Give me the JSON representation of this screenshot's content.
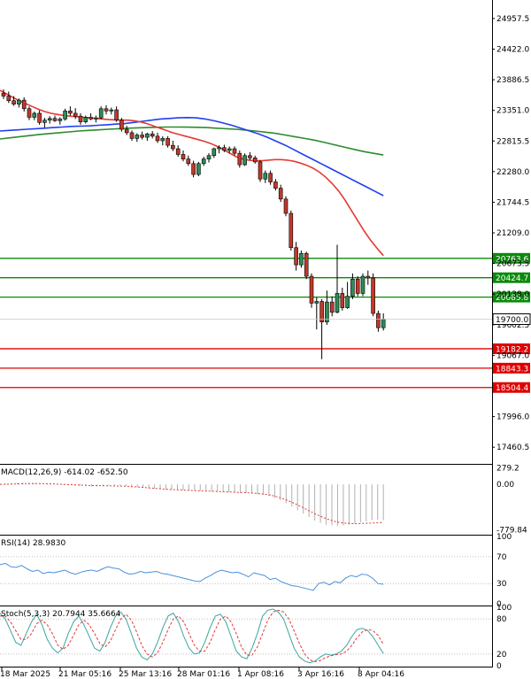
{
  "colors": {
    "bull": "#2e8b57",
    "bear": "#c0392b",
    "ma_fast": "#e53935",
    "ma_mid": "#1f3ff0",
    "ma_slow": "#2e8b2e",
    "level_green": "#0a8a0a",
    "level_red": "#e00000",
    "macd_hist": "#b0b0b0",
    "macd_signal": "#e53935",
    "rsi": "#4a90d9",
    "stoch_main": "#3aa6a0",
    "stoch_signal": "#e53935"
  },
  "chart_data": {
    "type": "candlestick",
    "price_axis": {
      "ticks": [
        "24957.5",
        "24422.0",
        "23886.5",
        "23351.0",
        "22815.5",
        "22280.0",
        "21744.5",
        "21209.0",
        "20673.5",
        "20138.0",
        "19602.5",
        "19067.0",
        "17996.0",
        "17460.5"
      ],
      "ylim": [
        17200,
        25250
      ]
    },
    "time_axis": {
      "ticks": [
        "18 Mar 2025",
        "21 Mar 05:16",
        "25 Mar 13:16",
        "28 Mar 01:16",
        "1 Apr 08:16",
        "3 Apr 16:16",
        "8 Apr 04:16"
      ]
    },
    "current_price": "19700.0",
    "levels": [
      {
        "value": 20763.6,
        "label": "20763.6",
        "kind": "resistance"
      },
      {
        "value": 20424.7,
        "label": "20424.7",
        "kind": "resistance"
      },
      {
        "value": 20085.8,
        "label": "20085.8",
        "kind": "resistance"
      },
      {
        "value": 19182.2,
        "label": "19182.2",
        "kind": "support"
      },
      {
        "value": 18843.3,
        "label": "18843.3",
        "kind": "support"
      },
      {
        "value": 18504.4,
        "label": "18504.4",
        "kind": "support"
      }
    ],
    "candles": [
      {
        "o": 23650,
        "h": 23720,
        "l": 23550,
        "c": 23600
      },
      {
        "o": 23600,
        "h": 23680,
        "l": 23480,
        "c": 23520
      },
      {
        "o": 23520,
        "h": 23600,
        "l": 23430,
        "c": 23460
      },
      {
        "o": 23460,
        "h": 23560,
        "l": 23400,
        "c": 23530
      },
      {
        "o": 23530,
        "h": 23580,
        "l": 23330,
        "c": 23380
      },
      {
        "o": 23380,
        "h": 23420,
        "l": 23180,
        "c": 23230
      },
      {
        "o": 23230,
        "h": 23330,
        "l": 23180,
        "c": 23300
      },
      {
        "o": 23300,
        "h": 23350,
        "l": 23100,
        "c": 23140
      },
      {
        "o": 23140,
        "h": 23220,
        "l": 23050,
        "c": 23180
      },
      {
        "o": 23180,
        "h": 23250,
        "l": 23120,
        "c": 23210
      },
      {
        "o": 23210,
        "h": 23260,
        "l": 23150,
        "c": 23170
      },
      {
        "o": 23170,
        "h": 23230,
        "l": 23100,
        "c": 23200
      },
      {
        "o": 23200,
        "h": 23380,
        "l": 23170,
        "c": 23340
      },
      {
        "o": 23340,
        "h": 23420,
        "l": 23260,
        "c": 23300
      },
      {
        "o": 23300,
        "h": 23390,
        "l": 23200,
        "c": 23250
      },
      {
        "o": 23250,
        "h": 23300,
        "l": 23100,
        "c": 23150
      },
      {
        "o": 23150,
        "h": 23260,
        "l": 23120,
        "c": 23230
      },
      {
        "o": 23230,
        "h": 23300,
        "l": 23180,
        "c": 23200
      },
      {
        "o": 23200,
        "h": 23260,
        "l": 23140,
        "c": 23220
      },
      {
        "o": 23220,
        "h": 23420,
        "l": 23200,
        "c": 23380
      },
      {
        "o": 23380,
        "h": 23440,
        "l": 23280,
        "c": 23340
      },
      {
        "o": 23340,
        "h": 23400,
        "l": 23280,
        "c": 23360
      },
      {
        "o": 23360,
        "h": 23420,
        "l": 23150,
        "c": 23180
      },
      {
        "o": 23180,
        "h": 23220,
        "l": 22980,
        "c": 23020
      },
      {
        "o": 23020,
        "h": 23080,
        "l": 22920,
        "c": 22960
      },
      {
        "o": 22960,
        "h": 23000,
        "l": 22820,
        "c": 22860
      },
      {
        "o": 22860,
        "h": 22950,
        "l": 22800,
        "c": 22920
      },
      {
        "o": 22920,
        "h": 22980,
        "l": 22840,
        "c": 22880
      },
      {
        "o": 22880,
        "h": 22960,
        "l": 22820,
        "c": 22940
      },
      {
        "o": 22940,
        "h": 22990,
        "l": 22860,
        "c": 22900
      },
      {
        "o": 22900,
        "h": 22960,
        "l": 22780,
        "c": 22820
      },
      {
        "o": 22820,
        "h": 22900,
        "l": 22740,
        "c": 22860
      },
      {
        "o": 22860,
        "h": 22900,
        "l": 22700,
        "c": 22740
      },
      {
        "o": 22740,
        "h": 22820,
        "l": 22640,
        "c": 22680
      },
      {
        "o": 22680,
        "h": 22740,
        "l": 22540,
        "c": 22580
      },
      {
        "o": 22580,
        "h": 22650,
        "l": 22460,
        "c": 22500
      },
      {
        "o": 22500,
        "h": 22560,
        "l": 22380,
        "c": 22420
      },
      {
        "o": 22420,
        "h": 22470,
        "l": 22180,
        "c": 22230
      },
      {
        "o": 22230,
        "h": 22450,
        "l": 22200,
        "c": 22420
      },
      {
        "o": 22420,
        "h": 22540,
        "l": 22380,
        "c": 22500
      },
      {
        "o": 22500,
        "h": 22600,
        "l": 22440,
        "c": 22560
      },
      {
        "o": 22560,
        "h": 22700,
        "l": 22520,
        "c": 22680
      },
      {
        "o": 22680,
        "h": 22740,
        "l": 22600,
        "c": 22700
      },
      {
        "o": 22700,
        "h": 22750,
        "l": 22620,
        "c": 22650
      },
      {
        "o": 22650,
        "h": 22720,
        "l": 22600,
        "c": 22680
      },
      {
        "o": 22680,
        "h": 22720,
        "l": 22560,
        "c": 22600
      },
      {
        "o": 22600,
        "h": 22650,
        "l": 22350,
        "c": 22400
      },
      {
        "o": 22400,
        "h": 22600,
        "l": 22380,
        "c": 22560
      },
      {
        "o": 22560,
        "h": 22620,
        "l": 22480,
        "c": 22520
      },
      {
        "o": 22520,
        "h": 22560,
        "l": 22420,
        "c": 22450
      },
      {
        "o": 22450,
        "h": 22480,
        "l": 22100,
        "c": 22150
      },
      {
        "o": 22150,
        "h": 22300,
        "l": 22080,
        "c": 22250
      },
      {
        "o": 22250,
        "h": 22300,
        "l": 22050,
        "c": 22100
      },
      {
        "o": 22100,
        "h": 22150,
        "l": 21950,
        "c": 21990
      },
      {
        "o": 21990,
        "h": 22050,
        "l": 21750,
        "c": 21800
      },
      {
        "o": 21800,
        "h": 21850,
        "l": 21500,
        "c": 21550
      },
      {
        "o": 21550,
        "h": 21600,
        "l": 20900,
        "c": 20950
      },
      {
        "o": 20950,
        "h": 21050,
        "l": 20550,
        "c": 20650
      },
      {
        "o": 20650,
        "h": 20900,
        "l": 20600,
        "c": 20850
      },
      {
        "o": 20850,
        "h": 20880,
        "l": 20400,
        "c": 20450
      },
      {
        "o": 20450,
        "h": 20500,
        "l": 19900,
        "c": 19980
      },
      {
        "o": 19980,
        "h": 20080,
        "l": 19520,
        "c": 20010
      },
      {
        "o": 20010,
        "h": 20050,
        "l": 19000,
        "c": 19650
      },
      {
        "o": 19650,
        "h": 20200,
        "l": 19600,
        "c": 20000
      },
      {
        "o": 20000,
        "h": 20100,
        "l": 19750,
        "c": 19820
      },
      {
        "o": 19820,
        "h": 21000,
        "l": 19800,
        "c": 20150
      },
      {
        "o": 20150,
        "h": 20250,
        "l": 19850,
        "c": 19900
      },
      {
        "o": 19900,
        "h": 20350,
        "l": 19880,
        "c": 20100
      },
      {
        "o": 20100,
        "h": 20500,
        "l": 20050,
        "c": 20400
      },
      {
        "o": 20400,
        "h": 20450,
        "l": 20100,
        "c": 20150
      },
      {
        "o": 20150,
        "h": 20500,
        "l": 20100,
        "c": 20450
      },
      {
        "o": 20450,
        "h": 20550,
        "l": 20300,
        "c": 20420
      },
      {
        "o": 20420,
        "h": 20500,
        "l": 19750,
        "c": 19800
      },
      {
        "o": 19800,
        "h": 19850,
        "l": 19480,
        "c": 19550
      },
      {
        "o": 19550,
        "h": 19800,
        "l": 19500,
        "c": 19700
      }
    ],
    "ma_fast": [
      23700,
      23640,
      23580,
      23520,
      23470,
      23420,
      23370,
      23330,
      23300,
      23280,
      23260,
      23250,
      23240,
      23230,
      23220,
      23210,
      23200,
      23190,
      23185,
      23180,
      23180,
      23170,
      23150,
      23120,
      23080,
      23040,
      23000,
      22960,
      22930,
      22900,
      22870,
      22840,
      22810,
      22770,
      22720,
      22660,
      22600,
      22540,
      22500,
      22480,
      22470,
      22470,
      22480,
      22490,
      22490,
      22480,
      22460,
      22430,
      22390,
      22340,
      22270,
      22180,
      22070,
      21940,
      21780,
      21600,
      21420,
      21240,
      21080,
      20940,
      20810
    ],
    "ma_mid": [
      22990,
      23000,
      23010,
      23020,
      23030,
      23040,
      23050,
      23060,
      23070,
      23075,
      23080,
      23090,
      23100,
      23110,
      23120,
      23140,
      23160,
      23180,
      23200,
      23210,
      23220,
      23225,
      23220,
      23200,
      23170,
      23130,
      23090,
      23040,
      22990,
      22940,
      22880,
      22810,
      22740,
      22660,
      22580,
      22500,
      22420,
      22340,
      22260,
      22180,
      22100,
      22020,
      21940,
      21860
    ],
    "ma_slow": [
      22850,
      22870,
      22890,
      22910,
      22930,
      22945,
      22960,
      22975,
      22990,
      23000,
      23010,
      23020,
      23030,
      23040,
      23045,
      23050,
      23055,
      23060,
      23060,
      23058,
      23055,
      23050,
      23040,
      23030,
      23020,
      23005,
      22990,
      22970,
      22950,
      22920,
      22890,
      22860,
      22830,
      22790,
      22750,
      22710,
      22670,
      22630,
      22600,
      22570
    ],
    "macd": {
      "label": "MACD(12,26,9) -614.02 -652.50",
      "ticks": [
        "279.2",
        "0.00",
        "-779.84"
      ],
      "ylim": [
        -830,
        320
      ],
      "hist": [
        10,
        15,
        20,
        25,
        30,
        28,
        22,
        15,
        8,
        0,
        -5,
        -10,
        -15,
        -20,
        -25,
        -30,
        -35,
        -30,
        -25,
        -20,
        -18,
        -22,
        -30,
        -40,
        -50,
        -60,
        -70,
        -80,
        -85,
        -90,
        -92,
        -95,
        -98,
        -100,
        -105,
        -110,
        -115,
        -120,
        -125,
        -130,
        -135,
        -140,
        -145,
        -150,
        -160,
        -170,
        -180,
        -200,
        -230,
        -270,
        -320,
        -380,
        -440,
        -500,
        -560,
        -620,
        -660,
        -690,
        -700,
        -705,
        -700,
        -690,
        -670,
        -650,
        -630,
        -610,
        -600,
        -610
      ],
      "signal": [
        0,
        2,
        5,
        8,
        12,
        14,
        15,
        14,
        12,
        8,
        4,
        0,
        -4,
        -8,
        -12,
        -16,
        -20,
        -22,
        -24,
        -25,
        -26,
        -28,
        -32,
        -38,
        -45,
        -52,
        -60,
        -68,
        -75,
        -82,
        -88,
        -93,
        -98,
        -102,
        -106,
        -110,
        -114,
        -118,
        -122,
        -126,
        -130,
        -134,
        -138,
        -142,
        -148,
        -155,
        -165,
        -180,
        -200,
        -230,
        -265,
        -305,
        -350,
        -400,
        -450,
        -500,
        -545,
        -585,
        -620,
        -645,
        -660,
        -670,
        -672,
        -670,
        -665,
        -660,
        -655,
        -652
      ]
    },
    "rsi": {
      "label": "RSI(14) 28.9830",
      "ticks": [
        "100",
        "70",
        "30",
        "0"
      ],
      "values": [
        58,
        60,
        55,
        54,
        57,
        52,
        48,
        50,
        45,
        47,
        46,
        48,
        50,
        46,
        44,
        47,
        49,
        50,
        48,
        52,
        55,
        53,
        52,
        47,
        44,
        45,
        48,
        46,
        47,
        48,
        45,
        44,
        42,
        40,
        38,
        36,
        34,
        33,
        38,
        42,
        47,
        50,
        48,
        46,
        47,
        44,
        40,
        46,
        44,
        42,
        36,
        38,
        33,
        30,
        27,
        26,
        24,
        22,
        20,
        30,
        32,
        28,
        33,
        31,
        38,
        42,
        40,
        44,
        43,
        38,
        30,
        29
      ]
    },
    "stoch": {
      "label": "Stoch(5,3,3) 20.7944 35.6664",
      "ticks": [
        "100",
        "80",
        "20",
        "0"
      ],
      "main": [
        90,
        80,
        60,
        40,
        35,
        55,
        75,
        88,
        70,
        45,
        30,
        22,
        30,
        55,
        75,
        85,
        70,
        50,
        30,
        25,
        40,
        65,
        85,
        92,
        80,
        55,
        30,
        15,
        10,
        20,
        40,
        65,
        85,
        90,
        75,
        50,
        30,
        20,
        22,
        40,
        65,
        85,
        88,
        75,
        50,
        25,
        15,
        12,
        30,
        55,
        85,
        95,
        97,
        92,
        80,
        55,
        30,
        15,
        8,
        5,
        8,
        15,
        20,
        18,
        20,
        25,
        35,
        50,
        62,
        64,
        60,
        50,
        35,
        21
      ],
      "signal": [
        85,
        85,
        75,
        60,
        45,
        45,
        55,
        72,
        78,
        70,
        55,
        35,
        28,
        35,
        52,
        70,
        78,
        70,
        55,
        38,
        32,
        42,
        62,
        80,
        88,
        78,
        58,
        35,
        20,
        15,
        22,
        40,
        62,
        80,
        85,
        75,
        55,
        35,
        25,
        25,
        40,
        62,
        80,
        85,
        75,
        55,
        32,
        18,
        18,
        32,
        55,
        78,
        92,
        95,
        92,
        80,
        60,
        38,
        20,
        10,
        7,
        9,
        14,
        17,
        19,
        20,
        25,
        35,
        48,
        58,
        62,
        60,
        52,
        36
      ]
    }
  }
}
